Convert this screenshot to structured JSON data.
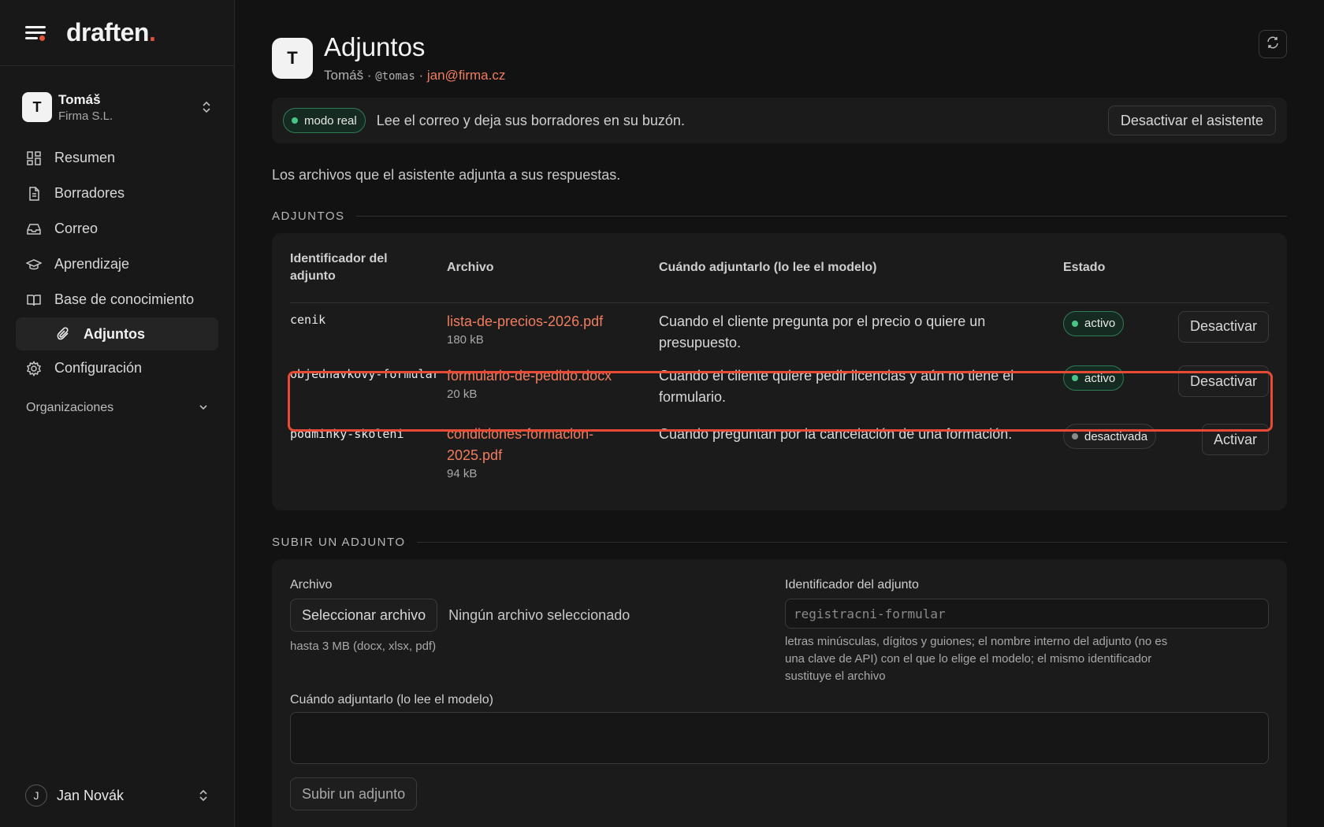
{
  "brand": {
    "logo_text": "draften",
    "logo_dot": "."
  },
  "org": {
    "initial": "T",
    "name": "Tomáš",
    "company": "Firma S.L."
  },
  "nav": {
    "items": [
      {
        "label": "Resumen",
        "icon": "dashboard-icon"
      },
      {
        "label": "Borradores",
        "icon": "document-icon"
      },
      {
        "label": "Correo",
        "icon": "inbox-icon"
      },
      {
        "label": "Aprendizaje",
        "icon": "graduation-cap-icon"
      },
      {
        "label": "Base de conocimiento",
        "icon": "book-icon"
      },
      {
        "label": "Adjuntos",
        "icon": "paperclip-icon"
      },
      {
        "label": "Configuración",
        "icon": "gear-icon"
      }
    ],
    "organizations_label": "Organizaciones"
  },
  "user": {
    "initial": "J",
    "name": "Jan Novák"
  },
  "header": {
    "initial": "T",
    "title": "Adjuntos",
    "meta_name": "Tomáš",
    "meta_sep": " · ",
    "handle": "@tomas",
    "email": "jan@firma.cz"
  },
  "banner": {
    "mode_label": "modo real",
    "text": "Lee el correo y deja sus borradores en su buzón.",
    "deactivate_label": "Desactivar el asistente"
  },
  "intro": "Los archivos que el asistente adjunta a sus respuestas.",
  "attachments": {
    "section_title": "ADJUNTOS",
    "columns": [
      "Identificador del adjunto",
      "Archivo",
      "Cuándo adjuntarlo (lo lee el modelo)",
      "Estado"
    ],
    "rows": [
      {
        "id": "cenik",
        "file": "lista-de-precios-2026.pdf",
        "size": "180 kB",
        "when": "Cuando el cliente pregunta por el precio o quiere un presupuesto.",
        "status": "activo",
        "action": "Desactivar"
      },
      {
        "id": "objednavkovy-formular",
        "file": "formulario-de-pedido.docx",
        "size": "20 kB",
        "when": "Cuando el cliente quiere pedir licencias y aún no tiene el formulario.",
        "status": "activo",
        "action": "Desactivar"
      },
      {
        "id": "podminky-skoleni",
        "file": "condiciones-formacion-2025.pdf",
        "size": "94 kB",
        "when": "Cuando preguntan por la cancelación de una formación.",
        "status": "desactivada",
        "action": "Activar"
      }
    ]
  },
  "upload": {
    "section_title": "SUBIR UN ADJUNTO",
    "file_label": "Archivo",
    "select_button": "Seleccionar archivo",
    "no_file": "Ningún archivo seleccionado",
    "file_hint": "hasta 3 MB (docx, xlsx, pdf)",
    "id_label": "Identificador del adjunto",
    "id_placeholder": "registracni-formular",
    "id_hint": "letras minúsculas, dígitos y guiones; el nombre interno del adjunto (no es una clave de API) con el que lo elige el modelo; el mismo identificador sustituye el archivo",
    "when_label": "Cuándo adjuntarlo (lo lee el modelo)",
    "when_value": "",
    "submit_label": "Subir un adjunto"
  },
  "colors": {
    "accent": "#f07d5f",
    "active_green": "#46c586",
    "highlight": "#e84b35"
  }
}
